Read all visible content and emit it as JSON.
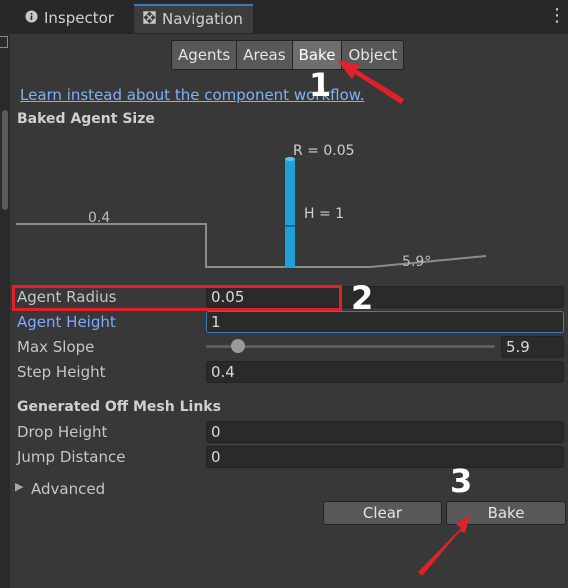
{
  "tabs": [
    {
      "label": "Inspector",
      "icon": "info-icon"
    },
    {
      "label": "Navigation",
      "icon": "navigation-icon"
    }
  ],
  "segments": [
    "Agents",
    "Areas",
    "Bake",
    "Object"
  ],
  "selected_segment": "Bake",
  "link_text": "Learn instead about the component workflow.",
  "baked_agent_size": {
    "title": "Baked Agent Size",
    "radius_label": "R = 0.05",
    "height_label": "H = 1",
    "step_label": "0.4",
    "slope_label": "5.9°"
  },
  "fields": {
    "agent_radius": {
      "label": "Agent Radius",
      "value": "0.05"
    },
    "agent_height": {
      "label": "Agent Height",
      "value": "1"
    },
    "max_slope": {
      "label": "Max Slope",
      "value": "5.9",
      "slider_fraction": 0.13
    },
    "step_height": {
      "label": "Step Height",
      "value": "0.4"
    }
  },
  "offmesh": {
    "title": "Generated Off Mesh Links",
    "drop_height": {
      "label": "Drop Height",
      "value": "0"
    },
    "jump_distance": {
      "label": "Jump Distance",
      "value": "0"
    }
  },
  "advanced_label": "Advanced",
  "buttons": {
    "clear": "Clear",
    "bake": "Bake"
  },
  "annotations": {
    "step1": "1",
    "step2": "2",
    "step3": "3",
    "color": "#e2202a"
  },
  "colors": {
    "accent": "#3a79bb",
    "link": "#7fb2f5",
    "agent": "#1ea0d8"
  }
}
